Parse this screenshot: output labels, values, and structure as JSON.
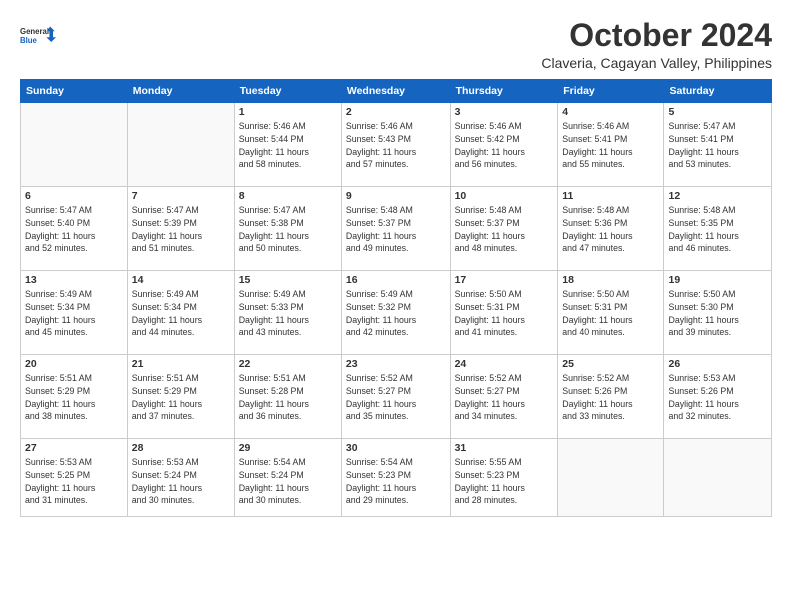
{
  "logo": {
    "line1": "General",
    "line2": "Blue"
  },
  "header": {
    "month": "October 2024",
    "location": "Claveria, Cagayan Valley, Philippines"
  },
  "weekdays": [
    "Sunday",
    "Monday",
    "Tuesday",
    "Wednesday",
    "Thursday",
    "Friday",
    "Saturday"
  ],
  "weeks": [
    [
      {
        "day": "",
        "info": ""
      },
      {
        "day": "",
        "info": ""
      },
      {
        "day": "1",
        "info": "Sunrise: 5:46 AM\nSunset: 5:44 PM\nDaylight: 11 hours\nand 58 minutes."
      },
      {
        "day": "2",
        "info": "Sunrise: 5:46 AM\nSunset: 5:43 PM\nDaylight: 11 hours\nand 57 minutes."
      },
      {
        "day": "3",
        "info": "Sunrise: 5:46 AM\nSunset: 5:42 PM\nDaylight: 11 hours\nand 56 minutes."
      },
      {
        "day": "4",
        "info": "Sunrise: 5:46 AM\nSunset: 5:41 PM\nDaylight: 11 hours\nand 55 minutes."
      },
      {
        "day": "5",
        "info": "Sunrise: 5:47 AM\nSunset: 5:41 PM\nDaylight: 11 hours\nand 53 minutes."
      }
    ],
    [
      {
        "day": "6",
        "info": "Sunrise: 5:47 AM\nSunset: 5:40 PM\nDaylight: 11 hours\nand 52 minutes."
      },
      {
        "day": "7",
        "info": "Sunrise: 5:47 AM\nSunset: 5:39 PM\nDaylight: 11 hours\nand 51 minutes."
      },
      {
        "day": "8",
        "info": "Sunrise: 5:47 AM\nSunset: 5:38 PM\nDaylight: 11 hours\nand 50 minutes."
      },
      {
        "day": "9",
        "info": "Sunrise: 5:48 AM\nSunset: 5:37 PM\nDaylight: 11 hours\nand 49 minutes."
      },
      {
        "day": "10",
        "info": "Sunrise: 5:48 AM\nSunset: 5:37 PM\nDaylight: 11 hours\nand 48 minutes."
      },
      {
        "day": "11",
        "info": "Sunrise: 5:48 AM\nSunset: 5:36 PM\nDaylight: 11 hours\nand 47 minutes."
      },
      {
        "day": "12",
        "info": "Sunrise: 5:48 AM\nSunset: 5:35 PM\nDaylight: 11 hours\nand 46 minutes."
      }
    ],
    [
      {
        "day": "13",
        "info": "Sunrise: 5:49 AM\nSunset: 5:34 PM\nDaylight: 11 hours\nand 45 minutes."
      },
      {
        "day": "14",
        "info": "Sunrise: 5:49 AM\nSunset: 5:34 PM\nDaylight: 11 hours\nand 44 minutes."
      },
      {
        "day": "15",
        "info": "Sunrise: 5:49 AM\nSunset: 5:33 PM\nDaylight: 11 hours\nand 43 minutes."
      },
      {
        "day": "16",
        "info": "Sunrise: 5:49 AM\nSunset: 5:32 PM\nDaylight: 11 hours\nand 42 minutes."
      },
      {
        "day": "17",
        "info": "Sunrise: 5:50 AM\nSunset: 5:31 PM\nDaylight: 11 hours\nand 41 minutes."
      },
      {
        "day": "18",
        "info": "Sunrise: 5:50 AM\nSunset: 5:31 PM\nDaylight: 11 hours\nand 40 minutes."
      },
      {
        "day": "19",
        "info": "Sunrise: 5:50 AM\nSunset: 5:30 PM\nDaylight: 11 hours\nand 39 minutes."
      }
    ],
    [
      {
        "day": "20",
        "info": "Sunrise: 5:51 AM\nSunset: 5:29 PM\nDaylight: 11 hours\nand 38 minutes."
      },
      {
        "day": "21",
        "info": "Sunrise: 5:51 AM\nSunset: 5:29 PM\nDaylight: 11 hours\nand 37 minutes."
      },
      {
        "day": "22",
        "info": "Sunrise: 5:51 AM\nSunset: 5:28 PM\nDaylight: 11 hours\nand 36 minutes."
      },
      {
        "day": "23",
        "info": "Sunrise: 5:52 AM\nSunset: 5:27 PM\nDaylight: 11 hours\nand 35 minutes."
      },
      {
        "day": "24",
        "info": "Sunrise: 5:52 AM\nSunset: 5:27 PM\nDaylight: 11 hours\nand 34 minutes."
      },
      {
        "day": "25",
        "info": "Sunrise: 5:52 AM\nSunset: 5:26 PM\nDaylight: 11 hours\nand 33 minutes."
      },
      {
        "day": "26",
        "info": "Sunrise: 5:53 AM\nSunset: 5:26 PM\nDaylight: 11 hours\nand 32 minutes."
      }
    ],
    [
      {
        "day": "27",
        "info": "Sunrise: 5:53 AM\nSunset: 5:25 PM\nDaylight: 11 hours\nand 31 minutes."
      },
      {
        "day": "28",
        "info": "Sunrise: 5:53 AM\nSunset: 5:24 PM\nDaylight: 11 hours\nand 30 minutes."
      },
      {
        "day": "29",
        "info": "Sunrise: 5:54 AM\nSunset: 5:24 PM\nDaylight: 11 hours\nand 30 minutes."
      },
      {
        "day": "30",
        "info": "Sunrise: 5:54 AM\nSunset: 5:23 PM\nDaylight: 11 hours\nand 29 minutes."
      },
      {
        "day": "31",
        "info": "Sunrise: 5:55 AM\nSunset: 5:23 PM\nDaylight: 11 hours\nand 28 minutes."
      },
      {
        "day": "",
        "info": ""
      },
      {
        "day": "",
        "info": ""
      }
    ]
  ]
}
